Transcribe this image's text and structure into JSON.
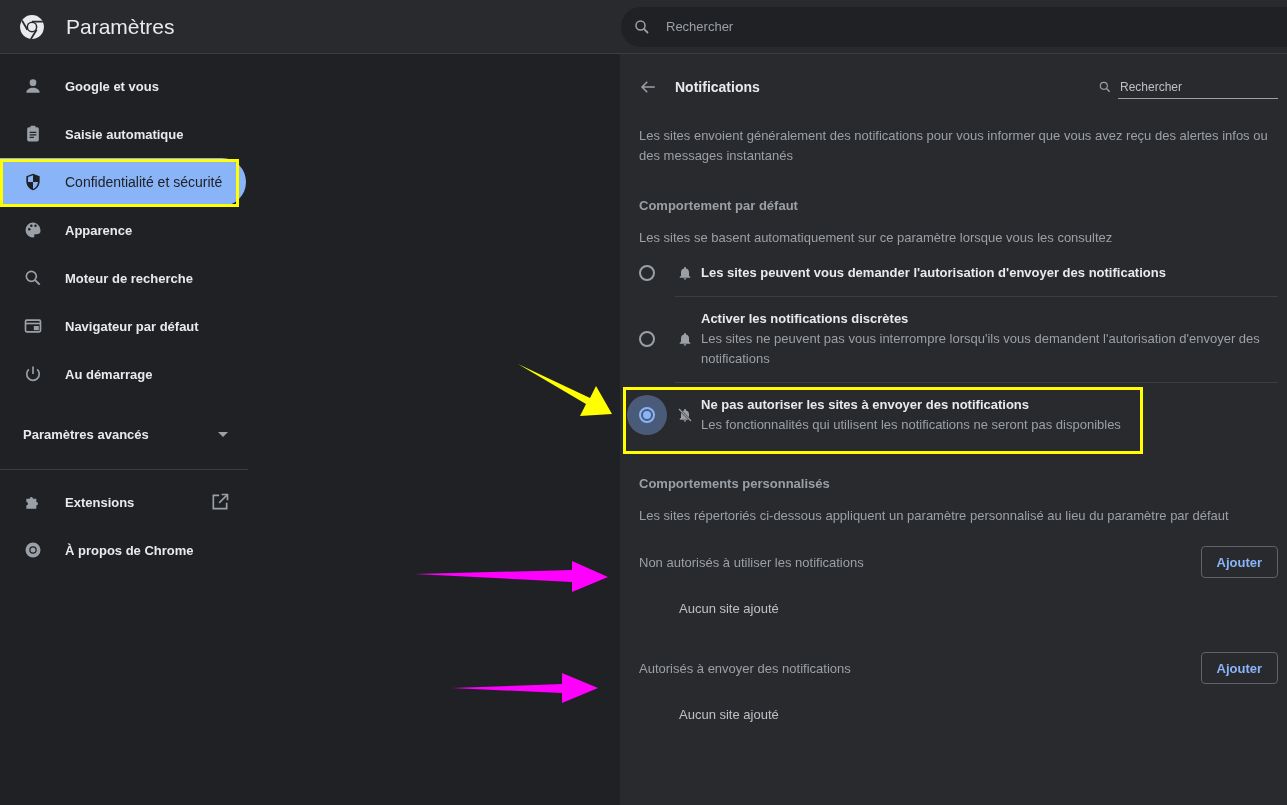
{
  "header": {
    "title": "Paramètres",
    "search_placeholder": "Rechercher"
  },
  "sidebar": {
    "items": [
      {
        "label": "Google et vous",
        "selected": false
      },
      {
        "label": "Saisie automatique",
        "selected": false
      },
      {
        "label": "Confidentialité et sécurité",
        "selected": true
      },
      {
        "label": "Apparence",
        "selected": false
      },
      {
        "label": "Moteur de recherche",
        "selected": false
      },
      {
        "label": "Navigateur par défaut",
        "selected": false
      },
      {
        "label": "Au démarrage",
        "selected": false
      }
    ],
    "advanced": {
      "label": "Paramètres avancés",
      "expanded": false
    },
    "links": [
      {
        "label": "Extensions",
        "external": true
      },
      {
        "label": "À propos de Chrome",
        "external": false
      }
    ]
  },
  "page": {
    "title": "Notifications",
    "search": {
      "placeholder": "Rechercher"
    },
    "description": "Les sites envoient généralement des notifications pour vous informer que vous avez reçu des alertes infos ou des messages instantanés",
    "default_section": {
      "heading": "Comportement par défaut",
      "subtitle": "Les sites se basent automatiquement sur ce paramètre lorsque vous les consultez",
      "options": [
        {
          "label": "Les sites peuvent vous demander l'autorisation d'envoyer des notifications",
          "selected": false
        },
        {
          "label": "Activer les notifications discrètes",
          "description": "Les sites ne peuvent pas vous interrompre lorsqu'ils vous demandent l'autorisation d'envoyer des notifications",
          "selected": false
        },
        {
          "label": "Ne pas autoriser les sites à envoyer des notifications",
          "description": "Les fonctionnalités qui utilisent les notifications ne seront pas disponibles",
          "selected": true
        }
      ]
    },
    "custom_section": {
      "heading": "Comportements personnalisés",
      "subtitle": "Les sites répertoriés ci-dessous appliquent un paramètre personnalisé au lieu du paramètre par défaut",
      "lists": [
        {
          "label": "Non autorisés à utiliser les notifications",
          "button": "Ajouter",
          "empty": "Aucun site ajouté"
        },
        {
          "label": "Autorisés à envoyer des notifications",
          "button": "Ajouter",
          "empty": "Aucun site ajouté"
        }
      ]
    }
  }
}
